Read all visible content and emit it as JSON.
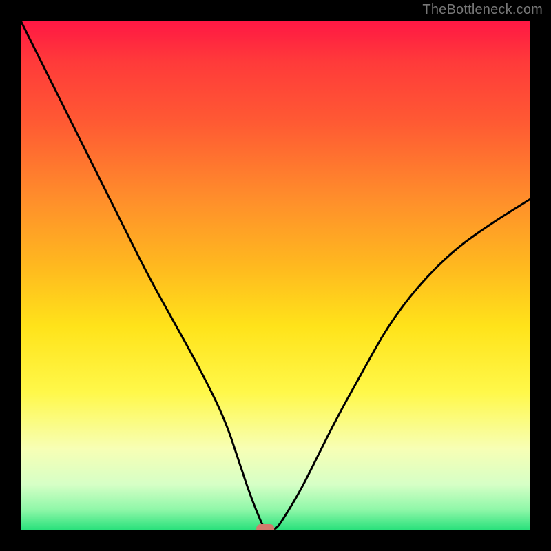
{
  "attribution": "TheBottleneck.com",
  "chart_data": {
    "type": "line",
    "title": "",
    "xlabel": "",
    "ylabel": "",
    "xlim": [
      0,
      100
    ],
    "ylim": [
      0,
      100
    ],
    "grid": false,
    "legend": false,
    "background": "rainbow-gradient",
    "marker": {
      "x": 48,
      "y": 0,
      "shape": "pill",
      "color": "#d27a6d"
    },
    "series": [
      {
        "name": "curve",
        "color": "#000000",
        "x": [
          0,
          5,
          10,
          15,
          20,
          25,
          30,
          35,
          40,
          43,
          45,
          47,
          48,
          50,
          52,
          55,
          58,
          62,
          67,
          72,
          78,
          85,
          92,
          100
        ],
        "y": [
          100,
          90,
          80,
          70,
          60,
          50,
          41,
          32,
          22,
          13,
          7,
          2,
          0,
          0,
          3,
          8,
          14,
          22,
          31,
          40,
          48,
          55,
          60,
          65
        ]
      }
    ]
  }
}
